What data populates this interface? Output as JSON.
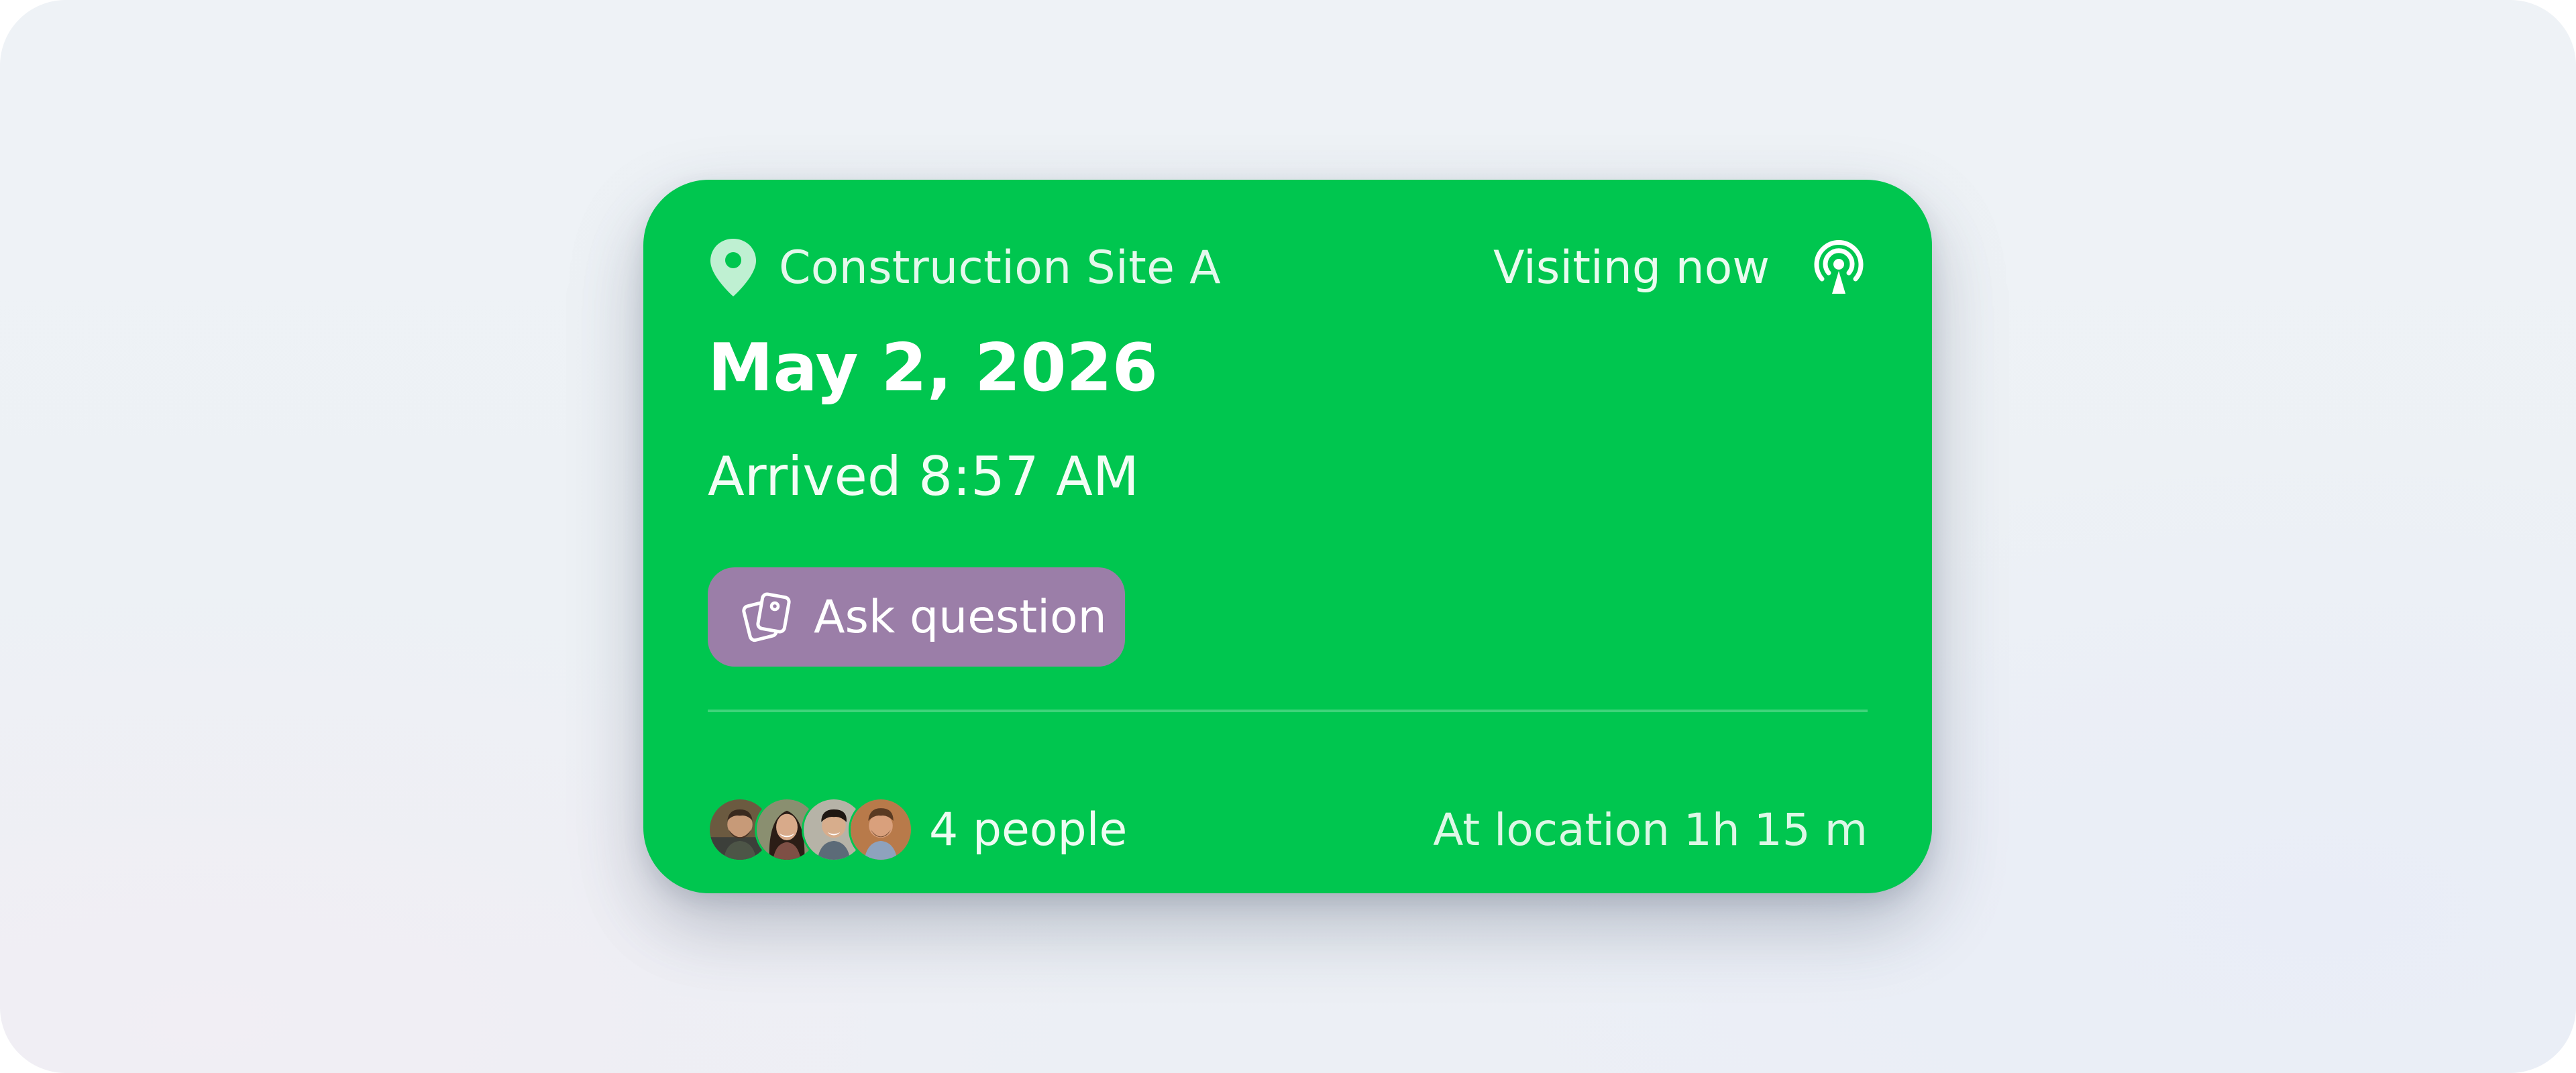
{
  "card": {
    "location": {
      "icon": "map-pin-icon",
      "name": "Construction Site A"
    },
    "status": {
      "label": "Visiting now",
      "icon": "broadcast-icon"
    },
    "date": "May 2, 2026",
    "arrived": "Arrived 8:57 AM",
    "ask_button": {
      "icon": "cards-icon",
      "label": "Ask question"
    },
    "footer": {
      "avatars": [
        "avatar-1",
        "avatar-2",
        "avatar-3",
        "avatar-4"
      ],
      "people_count": "4 people",
      "duration": "At location 1h 15 m"
    }
  },
  "colors": {
    "card_bg": "#00c64f",
    "button_bg": "#9b7ea8",
    "page_bg": "#eef2f6"
  }
}
